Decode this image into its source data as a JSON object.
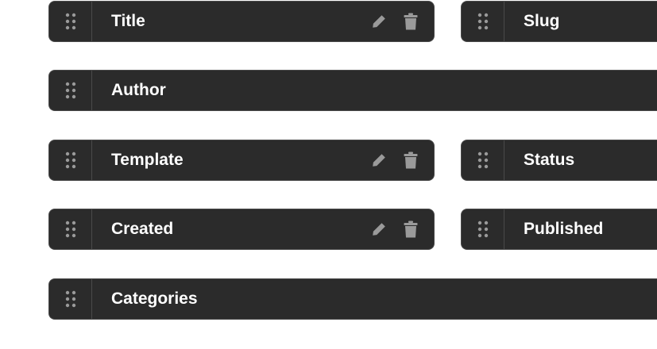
{
  "fields": {
    "title": {
      "label": "Title"
    },
    "slug": {
      "label": "Slug"
    },
    "author": {
      "label": "Author"
    },
    "template": {
      "label": "Template"
    },
    "status": {
      "label": "Status"
    },
    "created": {
      "label": "Created"
    },
    "published": {
      "label": "Published"
    },
    "categories": {
      "label": "Categories"
    }
  },
  "icons": {
    "handle": "drag-handle-icon",
    "edit": "pencil-icon",
    "delete": "trash-icon"
  },
  "colors": {
    "field_background": "#2b2b2b",
    "field_border": "#4a4a4a",
    "label_text": "#ffffff",
    "icon_gray": "#9a9a9a",
    "page_background": "#ffffff"
  }
}
